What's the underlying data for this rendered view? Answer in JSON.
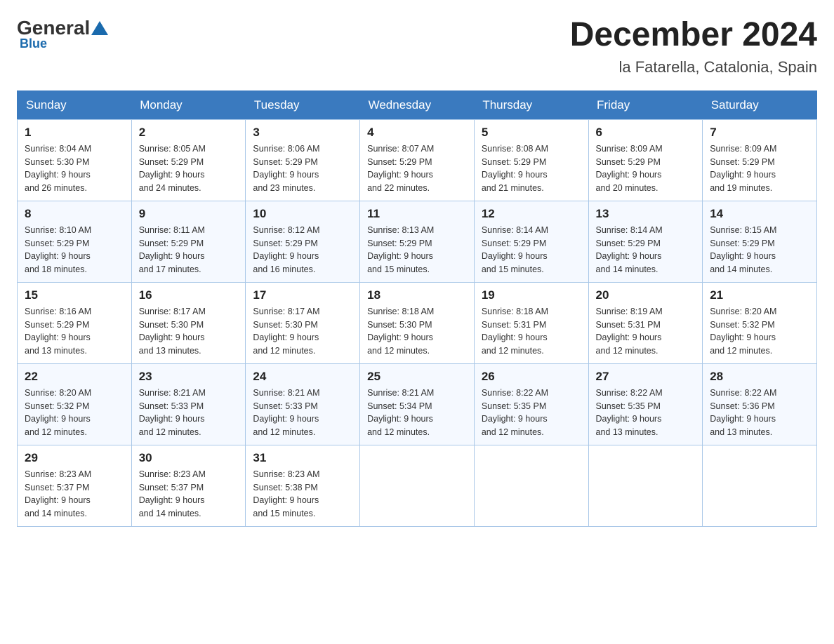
{
  "header": {
    "logo": {
      "general": "General",
      "blue": "Blue",
      "sub": "Blue"
    },
    "title": "December 2024",
    "location": "la Fatarella, Catalonia, Spain"
  },
  "days_of_week": [
    "Sunday",
    "Monday",
    "Tuesday",
    "Wednesday",
    "Thursday",
    "Friday",
    "Saturday"
  ],
  "weeks": [
    [
      {
        "day": "1",
        "sunrise": "8:04 AM",
        "sunset": "5:30 PM",
        "daylight": "9 hours and 26 minutes."
      },
      {
        "day": "2",
        "sunrise": "8:05 AM",
        "sunset": "5:29 PM",
        "daylight": "9 hours and 24 minutes."
      },
      {
        "day": "3",
        "sunrise": "8:06 AM",
        "sunset": "5:29 PM",
        "daylight": "9 hours and 23 minutes."
      },
      {
        "day": "4",
        "sunrise": "8:07 AM",
        "sunset": "5:29 PM",
        "daylight": "9 hours and 22 minutes."
      },
      {
        "day": "5",
        "sunrise": "8:08 AM",
        "sunset": "5:29 PM",
        "daylight": "9 hours and 21 minutes."
      },
      {
        "day": "6",
        "sunrise": "8:09 AM",
        "sunset": "5:29 PM",
        "daylight": "9 hours and 20 minutes."
      },
      {
        "day": "7",
        "sunrise": "8:09 AM",
        "sunset": "5:29 PM",
        "daylight": "9 hours and 19 minutes."
      }
    ],
    [
      {
        "day": "8",
        "sunrise": "8:10 AM",
        "sunset": "5:29 PM",
        "daylight": "9 hours and 18 minutes."
      },
      {
        "day": "9",
        "sunrise": "8:11 AM",
        "sunset": "5:29 PM",
        "daylight": "9 hours and 17 minutes."
      },
      {
        "day": "10",
        "sunrise": "8:12 AM",
        "sunset": "5:29 PM",
        "daylight": "9 hours and 16 minutes."
      },
      {
        "day": "11",
        "sunrise": "8:13 AM",
        "sunset": "5:29 PM",
        "daylight": "9 hours and 15 minutes."
      },
      {
        "day": "12",
        "sunrise": "8:14 AM",
        "sunset": "5:29 PM",
        "daylight": "9 hours and 15 minutes."
      },
      {
        "day": "13",
        "sunrise": "8:14 AM",
        "sunset": "5:29 PM",
        "daylight": "9 hours and 14 minutes."
      },
      {
        "day": "14",
        "sunrise": "8:15 AM",
        "sunset": "5:29 PM",
        "daylight": "9 hours and 14 minutes."
      }
    ],
    [
      {
        "day": "15",
        "sunrise": "8:16 AM",
        "sunset": "5:29 PM",
        "daylight": "9 hours and 13 minutes."
      },
      {
        "day": "16",
        "sunrise": "8:17 AM",
        "sunset": "5:30 PM",
        "daylight": "9 hours and 13 minutes."
      },
      {
        "day": "17",
        "sunrise": "8:17 AM",
        "sunset": "5:30 PM",
        "daylight": "9 hours and 12 minutes."
      },
      {
        "day": "18",
        "sunrise": "8:18 AM",
        "sunset": "5:30 PM",
        "daylight": "9 hours and 12 minutes."
      },
      {
        "day": "19",
        "sunrise": "8:18 AM",
        "sunset": "5:31 PM",
        "daylight": "9 hours and 12 minutes."
      },
      {
        "day": "20",
        "sunrise": "8:19 AM",
        "sunset": "5:31 PM",
        "daylight": "9 hours and 12 minutes."
      },
      {
        "day": "21",
        "sunrise": "8:20 AM",
        "sunset": "5:32 PM",
        "daylight": "9 hours and 12 minutes."
      }
    ],
    [
      {
        "day": "22",
        "sunrise": "8:20 AM",
        "sunset": "5:32 PM",
        "daylight": "9 hours and 12 minutes."
      },
      {
        "day": "23",
        "sunrise": "8:21 AM",
        "sunset": "5:33 PM",
        "daylight": "9 hours and 12 minutes."
      },
      {
        "day": "24",
        "sunrise": "8:21 AM",
        "sunset": "5:33 PM",
        "daylight": "9 hours and 12 minutes."
      },
      {
        "day": "25",
        "sunrise": "8:21 AM",
        "sunset": "5:34 PM",
        "daylight": "9 hours and 12 minutes."
      },
      {
        "day": "26",
        "sunrise": "8:22 AM",
        "sunset": "5:35 PM",
        "daylight": "9 hours and 12 minutes."
      },
      {
        "day": "27",
        "sunrise": "8:22 AM",
        "sunset": "5:35 PM",
        "daylight": "9 hours and 13 minutes."
      },
      {
        "day": "28",
        "sunrise": "8:22 AM",
        "sunset": "5:36 PM",
        "daylight": "9 hours and 13 minutes."
      }
    ],
    [
      {
        "day": "29",
        "sunrise": "8:23 AM",
        "sunset": "5:37 PM",
        "daylight": "9 hours and 14 minutes."
      },
      {
        "day": "30",
        "sunrise": "8:23 AM",
        "sunset": "5:37 PM",
        "daylight": "9 hours and 14 minutes."
      },
      {
        "day": "31",
        "sunrise": "8:23 AM",
        "sunset": "5:38 PM",
        "daylight": "9 hours and 15 minutes."
      },
      null,
      null,
      null,
      null
    ]
  ],
  "labels": {
    "sunrise": "Sunrise:",
    "sunset": "Sunset:",
    "daylight": "Daylight:"
  }
}
